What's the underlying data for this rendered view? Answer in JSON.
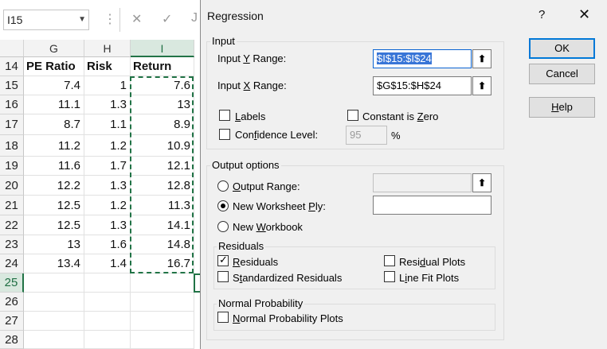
{
  "excel": {
    "name_box": "I15",
    "toolbar_icons": [
      "more-options-icon",
      "cancel-icon",
      "enter-icon",
      "function-icon"
    ],
    "toolbar_glyphs": {
      "more": "⋮",
      "cancel": "✕",
      "enter": "✓",
      "fx": "J"
    },
    "columns": [
      "G",
      "H",
      "I"
    ],
    "row_numbers": [
      "14",
      "15",
      "16",
      "17",
      "18",
      "19",
      "20",
      "21",
      "22",
      "23",
      "24",
      "25",
      "26",
      "27",
      "28"
    ],
    "headers": {
      "g": "PE Ratio",
      "h": "Risk",
      "i": "Return"
    },
    "rows": [
      {
        "g": "7.4",
        "h": "1",
        "i": "7.6"
      },
      {
        "g": "11.1",
        "h": "1.3",
        "i": "13"
      },
      {
        "g": "8.7",
        "h": "1.1",
        "i": "8.9"
      },
      {
        "g": "11.2",
        "h": "1.2",
        "i": "10.9"
      },
      {
        "g": "11.6",
        "h": "1.7",
        "i": "12.1"
      },
      {
        "g": "12.2",
        "h": "1.3",
        "i": "12.8"
      },
      {
        "g": "12.5",
        "h": "1.2",
        "i": "11.3"
      },
      {
        "g": "12.5",
        "h": "1.3",
        "i": "14.1"
      },
      {
        "g": "13",
        "h": "1.6",
        "i": "14.8"
      },
      {
        "g": "13.4",
        "h": "1.4",
        "i": "16.7"
      }
    ],
    "selected_row": "25"
  },
  "dialog": {
    "title": "Regression",
    "help_glyph": "?",
    "close_glyph": "✕",
    "input": {
      "group_label": "Input",
      "y_range_label_pre": "Input ",
      "y_range_label_u": "Y",
      "y_range_label_post": " Range:",
      "y_range_value": "$I$15:$I$24",
      "x_range_label_pre": "Input ",
      "x_range_label_u": "X",
      "x_range_label_post": " Range:",
      "x_range_value": "$G$15:$H$24",
      "labels_u": "L",
      "labels_rest": "abels",
      "constant_pre": "Constant is ",
      "constant_u": "Z",
      "constant_rest": "ero",
      "confidence_pre": "Con",
      "confidence_u": "f",
      "confidence_rest": "idence Level:",
      "confidence_value": "95",
      "percent_sign": "%"
    },
    "output": {
      "group_label": "Output options",
      "output_range_u": "O",
      "output_range_rest": "utput Range:",
      "output_range_value": "",
      "new_ply_pre": "New Worksheet ",
      "new_ply_u": "P",
      "new_ply_rest": "ly:",
      "new_ply_value": "",
      "new_workbook_pre": "New ",
      "new_workbook_u": "W",
      "new_workbook_rest": "orkbook",
      "selected_option": "New Worksheet Ply"
    },
    "residuals": {
      "group_label": "Residuals",
      "residuals_u": "R",
      "residuals_rest": "esiduals",
      "residuals_checked": true,
      "standardized_pre": "S",
      "standardized_u": "t",
      "standardized_rest": "andardized Residuals",
      "residual_plots_pre": "Resi",
      "residual_plots_u": "d",
      "residual_plots_rest": "ual Plots",
      "line_fit_pre": "L",
      "line_fit_u": "i",
      "line_fit_rest": "ne Fit Plots"
    },
    "normal_probability": {
      "group_label": "Normal Probability",
      "plots_u": "N",
      "plots_rest": "ormal Probability Plots"
    },
    "buttons": {
      "ok": "OK",
      "cancel": "Cancel",
      "help_u": "H",
      "help_rest": "elp"
    },
    "collapse_glyph": "⬆"
  }
}
